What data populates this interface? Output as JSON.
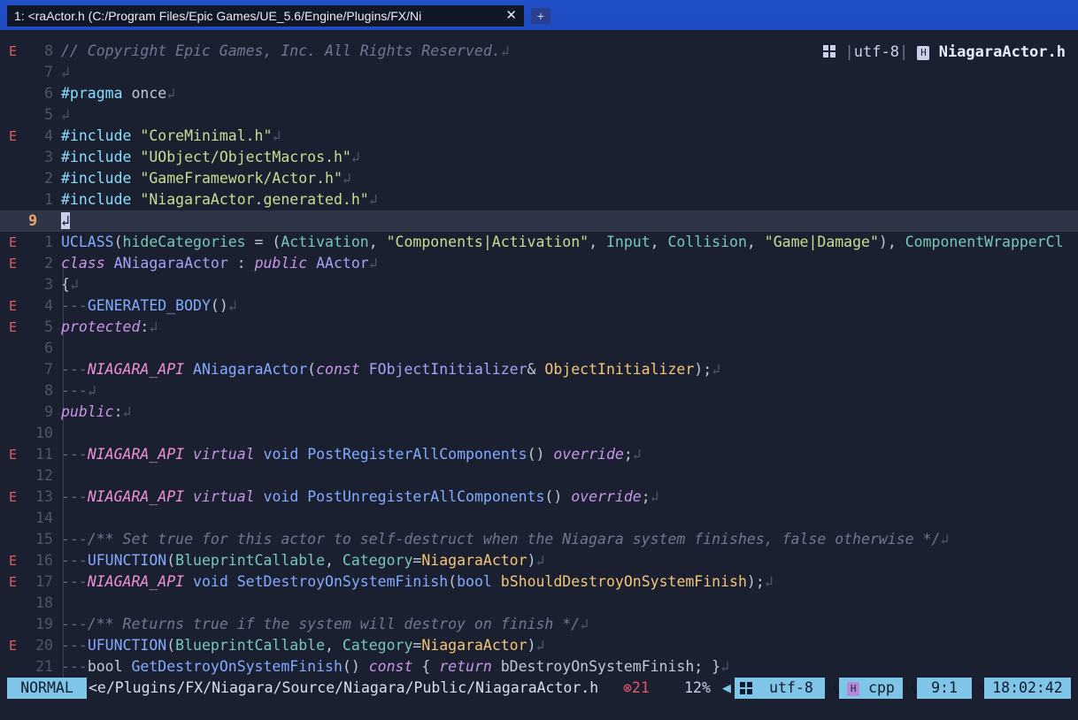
{
  "tab": {
    "title": "1: <raActor.h (C:/Program Files/Epic Games/UE_5.6/Engine/Plugins/FX/Ni",
    "close_glyph": "✕",
    "new_tab_glyph": "+"
  },
  "winbar": {
    "encoding": "utf-8",
    "filename": "NiagaraActor.h",
    "file_icon_glyph": "H",
    "os_icon": "windows-icon"
  },
  "editor": {
    "lines": [
      {
        "num": "8",
        "err": "E",
        "cur": false,
        "html": "<span class=\"c-com\">// Copyright Epic Games, Inc. All Rights Reserved.</span><span class=\"c-nl\">↲</span>"
      },
      {
        "num": "7",
        "err": "",
        "cur": false,
        "html": "<span class=\"c-nl\">↲</span>"
      },
      {
        "num": "6",
        "err": "",
        "cur": false,
        "html": "<span class=\"c-pp\">#pragma</span> once<span class=\"c-nl\">↲</span>"
      },
      {
        "num": "5",
        "err": "",
        "cur": false,
        "html": "<span class=\"c-nl\">↲</span>"
      },
      {
        "num": "4",
        "err": "E",
        "cur": false,
        "html": "<span class=\"c-pp\">#include</span> <span class=\"c-str\">\"CoreMinimal.h\"</span><span class=\"c-nl\">↲</span>"
      },
      {
        "num": "3",
        "err": "",
        "cur": false,
        "html": "<span class=\"c-pp\">#include</span> <span class=\"c-str\">\"UObject/ObjectMacros.h\"</span><span class=\"c-nl\">↲</span>"
      },
      {
        "num": "2",
        "err": "",
        "cur": false,
        "html": "<span class=\"c-pp\">#include</span> <span class=\"c-str\">\"GameFramework/Actor.h\"</span><span class=\"c-nl\">↲</span>"
      },
      {
        "num": "1",
        "err": "",
        "cur": false,
        "html": "<span class=\"c-pp\">#include</span> <span class=\"c-str\">\"NiagaraActor.generated.h\"</span><span class=\"c-nl\">↲</span>"
      },
      {
        "num": "9",
        "err": "",
        "cur": true,
        "html": "<span class=\"c-nl\" style=\"background:#c9d2ea;color:#1b2030\">↲</span>"
      },
      {
        "num": "1",
        "err": "E",
        "cur": false,
        "html": "<span class=\"c-fn\">UCLASS</span>(<span class=\"c-typ\">hideCategories</span> = (<span class=\"c-typ\">Activation</span>, <span class=\"c-str\">\"Components|Activation\"</span>, <span class=\"c-typ\">Input</span>, <span class=\"c-typ\">Collision</span>, <span class=\"c-str\">\"Game|Damage\"</span>), <span class=\"c-typ\">ComponentWrapperCl</span>"
      },
      {
        "num": "2",
        "err": "E",
        "cur": false,
        "html": "<span class=\"c-kw\">class</span> <span class=\"c-cls\">ANiagaraActor</span> : <span class=\"c-kw\">public</span> <span class=\"c-cls\">AActor</span><span class=\"c-nl\">↲</span>"
      },
      {
        "num": "3",
        "err": "",
        "cur": false,
        "html": "{<span class=\"c-nl\">↲</span>"
      },
      {
        "num": "4",
        "err": "E",
        "cur": false,
        "html": "<span class=\"c-ln\">---</span><span class=\"c-fn\">GENERATED_BODY</span>()<span class=\"c-nl\">↲</span>"
      },
      {
        "num": "5",
        "err": "E",
        "cur": false,
        "html": "<span class=\"c-kw\">protected</span>:<span class=\"c-nl\">↲</span>"
      },
      {
        "num": "6",
        "err": "",
        "cur": false,
        "html": ""
      },
      {
        "num": "7",
        "err": "",
        "cur": false,
        "html": "<span class=\"c-ln\">---</span><span class=\"c-mac\">NIAGARA_API</span> <span class=\"c-fn\">ANiagaraActor</span>(<span class=\"c-kw\">const</span> <span class=\"c-cls\">FObjectInitializer</span>&amp; <span class=\"c-par\">ObjectInitializer</span>);<span class=\"c-nl\">↲</span>"
      },
      {
        "num": "8",
        "err": "",
        "cur": false,
        "html": "<span class=\"c-ln\">---</span><span class=\"c-nl\">↲</span>"
      },
      {
        "num": "9",
        "err": "",
        "cur": false,
        "html": "<span class=\"c-kw\">public</span>:<span class=\"c-nl\">↲</span>"
      },
      {
        "num": "10",
        "err": "",
        "cur": false,
        "html": ""
      },
      {
        "num": "11",
        "err": "E",
        "cur": false,
        "html": "<span class=\"c-ln\">---</span><span class=\"c-mac\">NIAGARA_API</span> <span class=\"c-kw\">virtual</span> <span class=\"c-fn\">void</span> <span class=\"c-fn\">PostRegisterAllComponents</span>() <span class=\"c-kw\">override</span>;<span class=\"c-nl\">↲</span>"
      },
      {
        "num": "12",
        "err": "",
        "cur": false,
        "html": ""
      },
      {
        "num": "13",
        "err": "E",
        "cur": false,
        "html": "<span class=\"c-ln\">---</span><span class=\"c-mac\">NIAGARA_API</span> <span class=\"c-kw\">virtual</span> <span class=\"c-fn\">void</span> <span class=\"c-fn\">PostUnregisterAllComponents</span>() <span class=\"c-kw\">override</span>;<span class=\"c-nl\">↲</span>"
      },
      {
        "num": "14",
        "err": "",
        "cur": false,
        "html": ""
      },
      {
        "num": "15",
        "err": "",
        "cur": false,
        "html": "<span class=\"c-ln\">---</span><span class=\"c-com\">/** Set true for this actor to self-destruct when the Niagara system finishes, false otherwise */</span><span class=\"c-nl\">↲</span>"
      },
      {
        "num": "16",
        "err": "E",
        "cur": false,
        "html": "<span class=\"c-ln\">---</span><span class=\"c-fn\">UFUNCTION</span>(<span class=\"c-typ\">BlueprintCallable</span>, <span class=\"c-typ\">Category</span>=<span class=\"c-par\">NiagaraActor</span>)<span class=\"c-nl\">↲</span>"
      },
      {
        "num": "17",
        "err": "E",
        "cur": false,
        "html": "<span class=\"c-ln\">---</span><span class=\"c-mac\">NIAGARA_API</span> <span class=\"c-fn\">void</span> <span class=\"c-fn\">SetDestroyOnSystemFinish</span>(<span class=\"c-fn\">bool</span> <span class=\"c-par\">bShouldDestroyOnSystemFinish</span>);<span class=\"c-nl\">↲</span>"
      },
      {
        "num": "18",
        "err": "",
        "cur": false,
        "html": ""
      },
      {
        "num": "19",
        "err": "",
        "cur": false,
        "html": "<span class=\"c-ln\">---</span><span class=\"c-com\">/** Returns true if the system will destroy on finish */</span><span class=\"c-nl\">↲</span>"
      },
      {
        "num": "20",
        "err": "E",
        "cur": false,
        "html": "<span class=\"c-ln\">---</span><span class=\"c-fn\">UFUNCTION</span>(<span class=\"c-typ\">BlueprintCallable</span>, <span class=\"c-typ\">Category</span>=<span class=\"c-par\">NiagaraActor</span>)<span class=\"c-nl\">↲</span>"
      },
      {
        "num": "21",
        "err": "",
        "cur": false,
        "html": "<span class=\"c-ln\">---</span>bool <span class=\"c-fn\">GetDestroyOnSystemFinish</span>() <span class=\"c-kw\">const</span> { <span class=\"c-kw\">return</span> bDestroyOnSystemFinish; }<span class=\"c-nl\">↲</span>"
      }
    ]
  },
  "statusbar": {
    "mode": "NORMAL",
    "path": "<e/Plugins/FX/Niagara/Source/Niagara/Public/NiagaraActor.h",
    "error_count": "⊗21",
    "percent": "12%",
    "encoding": "utf-8",
    "filetype": "cpp",
    "filetype_icon_glyph": "H",
    "position": "9:1",
    "time": "18:02:42"
  },
  "colors": {
    "mode_bg": "#7ec5e8",
    "error": "#e4566c",
    "editor_bg": "#1b2030"
  }
}
